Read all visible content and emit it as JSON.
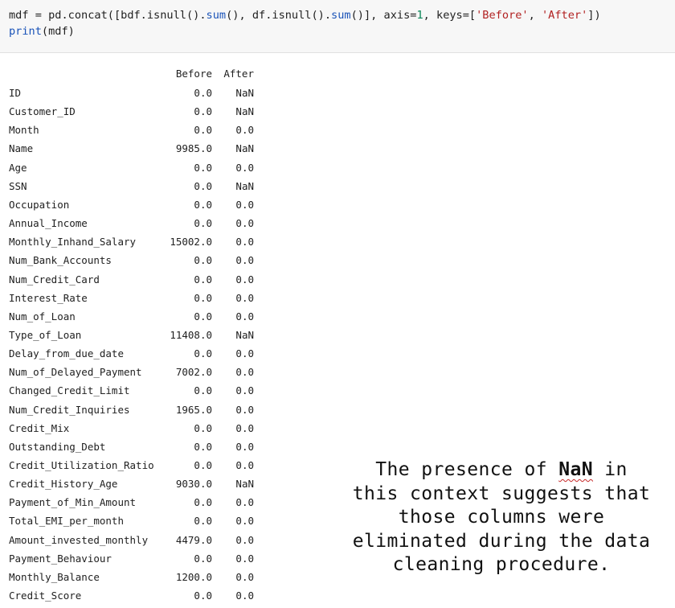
{
  "code_cell": {
    "line1": {
      "p1": "mdf = pd.concat([bdf.isnull().",
      "f1": "sum",
      "p2": "(), df.isnull().",
      "f2": "sum",
      "p3": "()], axis=",
      "n1": "1",
      "p4": ", keys=[",
      "s1": "'Before'",
      "p5": ", ",
      "s2": "'After'",
      "p6": "])"
    },
    "line2": {
      "f1": "print",
      "p1": "(mdf)"
    }
  },
  "output": {
    "columns": {
      "before": "Before",
      "after": "After"
    },
    "rows": [
      {
        "name": "ID",
        "before": "0.0",
        "after": "NaN"
      },
      {
        "name": "Customer_ID",
        "before": "0.0",
        "after": "NaN"
      },
      {
        "name": "Month",
        "before": "0.0",
        "after": "0.0"
      },
      {
        "name": "Name",
        "before": "9985.0",
        "after": "NaN"
      },
      {
        "name": "Age",
        "before": "0.0",
        "after": "0.0"
      },
      {
        "name": "SSN",
        "before": "0.0",
        "after": "NaN"
      },
      {
        "name": "Occupation",
        "before": "0.0",
        "after": "0.0"
      },
      {
        "name": "Annual_Income",
        "before": "0.0",
        "after": "0.0"
      },
      {
        "name": "Monthly_Inhand_Salary",
        "before": "15002.0",
        "after": "0.0"
      },
      {
        "name": "Num_Bank_Accounts",
        "before": "0.0",
        "after": "0.0"
      },
      {
        "name": "Num_Credit_Card",
        "before": "0.0",
        "after": "0.0"
      },
      {
        "name": "Interest_Rate",
        "before": "0.0",
        "after": "0.0"
      },
      {
        "name": "Num_of_Loan",
        "before": "0.0",
        "after": "0.0"
      },
      {
        "name": "Type_of_Loan",
        "before": "11408.0",
        "after": "NaN"
      },
      {
        "name": "Delay_from_due_date",
        "before": "0.0",
        "after": "0.0"
      },
      {
        "name": "Num_of_Delayed_Payment",
        "before": "7002.0",
        "after": "0.0"
      },
      {
        "name": "Changed_Credit_Limit",
        "before": "0.0",
        "after": "0.0"
      },
      {
        "name": "Num_Credit_Inquiries",
        "before": "1965.0",
        "after": "0.0"
      },
      {
        "name": "Credit_Mix",
        "before": "0.0",
        "after": "0.0"
      },
      {
        "name": "Outstanding_Debt",
        "before": "0.0",
        "after": "0.0"
      },
      {
        "name": "Credit_Utilization_Ratio",
        "before": "0.0",
        "after": "0.0"
      },
      {
        "name": "Credit_History_Age",
        "before": "9030.0",
        "after": "NaN"
      },
      {
        "name": "Payment_of_Min_Amount",
        "before": "0.0",
        "after": "0.0"
      },
      {
        "name": "Total_EMI_per_month",
        "before": "0.0",
        "after": "0.0"
      },
      {
        "name": "Amount_invested_monthly",
        "before": "4479.0",
        "after": "0.0"
      },
      {
        "name": "Payment_Behaviour",
        "before": "0.0",
        "after": "0.0"
      },
      {
        "name": "Monthly_Balance",
        "before": "1200.0",
        "after": "0.0"
      },
      {
        "name": "Credit_Score",
        "before": "0.0",
        "after": "0.0"
      }
    ]
  },
  "note": {
    "before": "The presence of ",
    "highlight": "NaN",
    "after": " in this context suggests that those columns were eliminated during the data cleaning procedure."
  }
}
